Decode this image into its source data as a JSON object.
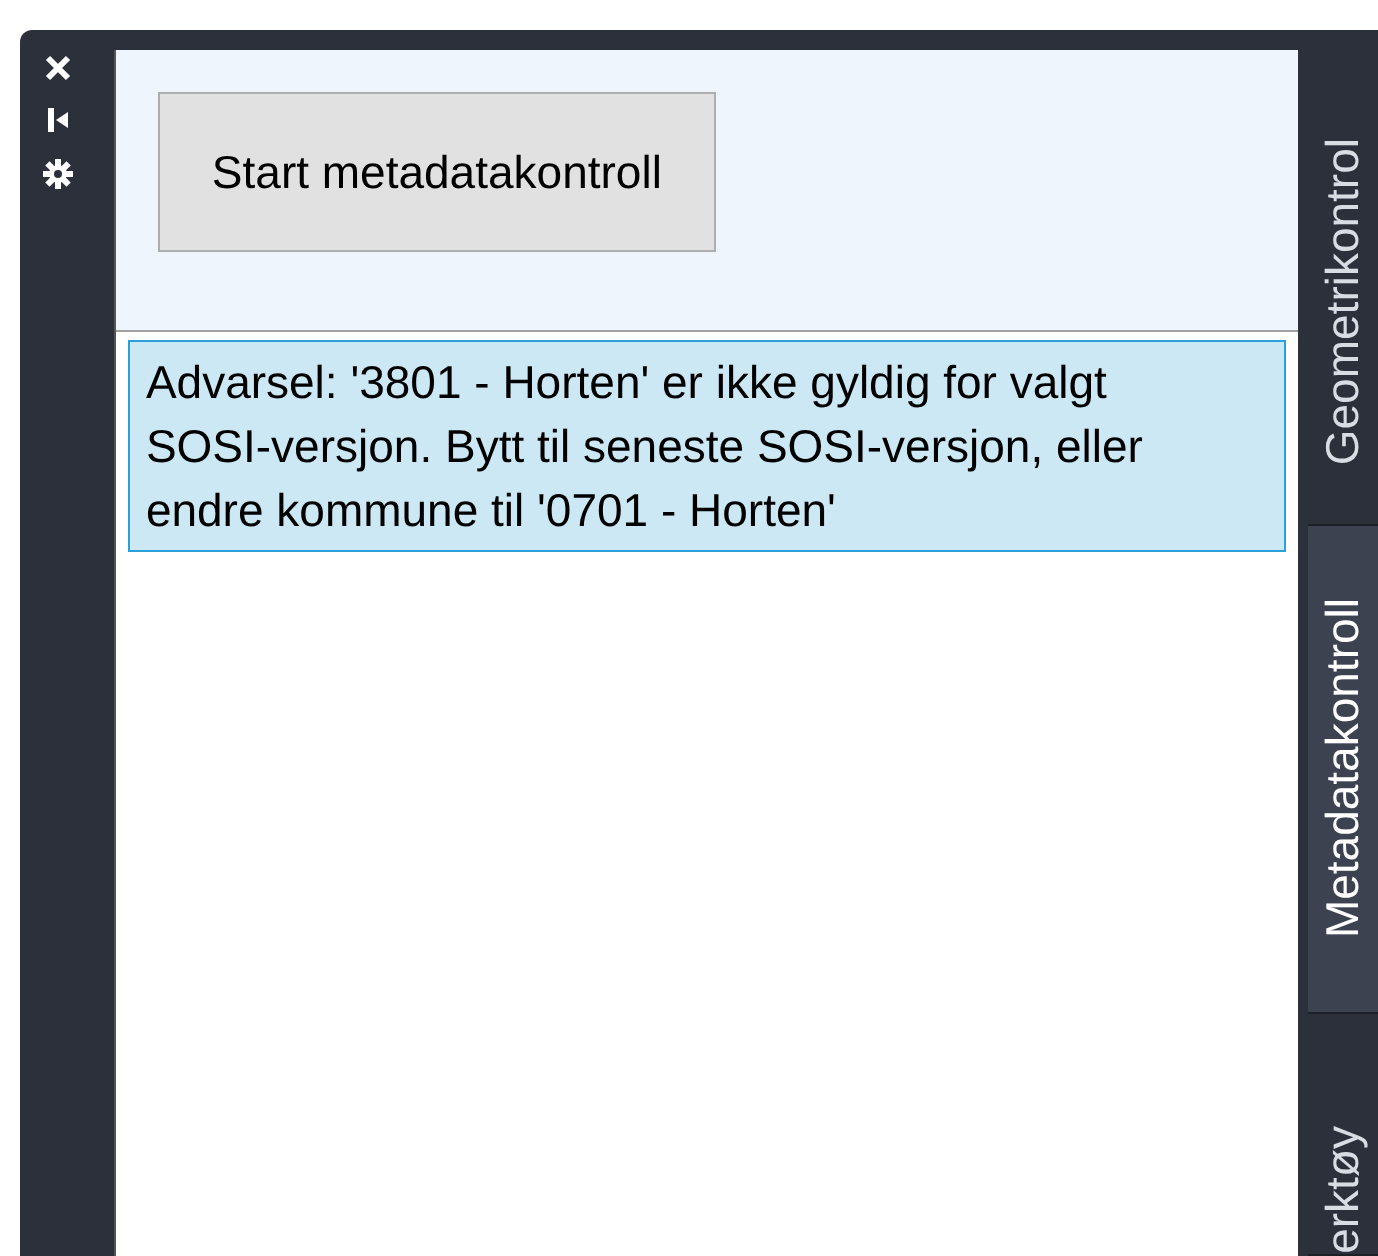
{
  "start_button": {
    "label": "Start metadatakontroll"
  },
  "messages": [
    {
      "text": "Advarsel: '3801 - Horten' er ikke gyldig for valgt SOSI-versjon. Bytt til seneste SOSI-versjon, eller endre kommune til '0701 - Horten'",
      "selected": true
    }
  ],
  "tabs": [
    {
      "label": "Geometrikontrol",
      "selected": false
    },
    {
      "label": "Metadatakontroll",
      "selected": true
    },
    {
      "label": "erktøy",
      "selected": false
    }
  ]
}
